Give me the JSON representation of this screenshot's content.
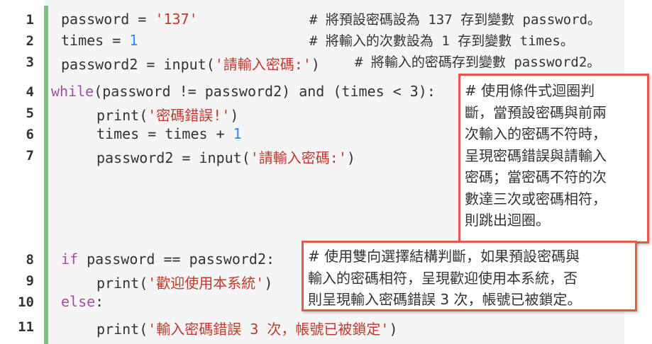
{
  "lines": [
    {
      "no": "1",
      "a": "password = ",
      "s": "'137'",
      "cmt": "# 將預設密碼設為 137 存到變數 password。"
    },
    {
      "no": "2",
      "a": "times = ",
      "n": "1",
      "cmt": "# 將輸入的次數設為 1 存到變數 times。"
    },
    {
      "no": "3",
      "a": "password2 = input(",
      "s": "'請輸入密碼:'",
      "b": ")",
      "cmt": "# 將輸入的密碼存到變數 password2。"
    },
    {
      "no": "4",
      "k": "while",
      "a": "(password != password2) and (times < 3):"
    },
    {
      "no": "5",
      "a": "print(",
      "s": "'密碼錯誤!'",
      "b": ")"
    },
    {
      "no": "6",
      "a": "times = times + ",
      "n": "1"
    },
    {
      "no": "7",
      "a": "password2 = input(",
      "s": "'請輸入密碼:'",
      "b": ")"
    },
    {
      "no": "8",
      "k": "if",
      "a": " password == password2:"
    },
    {
      "no": "9",
      "a": "print(",
      "s": "'歡迎使用本系統'",
      "b": ")"
    },
    {
      "no": "10",
      "k": "else",
      "a": ":"
    },
    {
      "no": "11",
      "a": "print(",
      "s": "'輸入密碼錯誤 3 次，帳號已被鎖定'",
      "b": ")"
    }
  ],
  "note_while": [
    "# 使用條件式迴圈判",
    "斷，當預設密碼與前兩",
    "次輸入的密碼不符時，",
    "呈現密碼錯誤與請輸入",
    "密碼；當密碼不符的次",
    "數達三次或密碼相符，",
    "則跳出迴圈。"
  ],
  "note_if": [
    "# 使用雙向選擇結構判斷，如果預設密碼與",
    "輸入的密碼相符，呈現歡迎使用本系統，否",
    "則呈現輸入密碼錯誤 3 次，帳號已被鎖定。"
  ],
  "colors": {
    "string": "#c0392b",
    "number": "#1e90ff",
    "keyword": "#a64ca6",
    "callout_border": "#e05b4b",
    "gutter": "#7fbf7f"
  }
}
